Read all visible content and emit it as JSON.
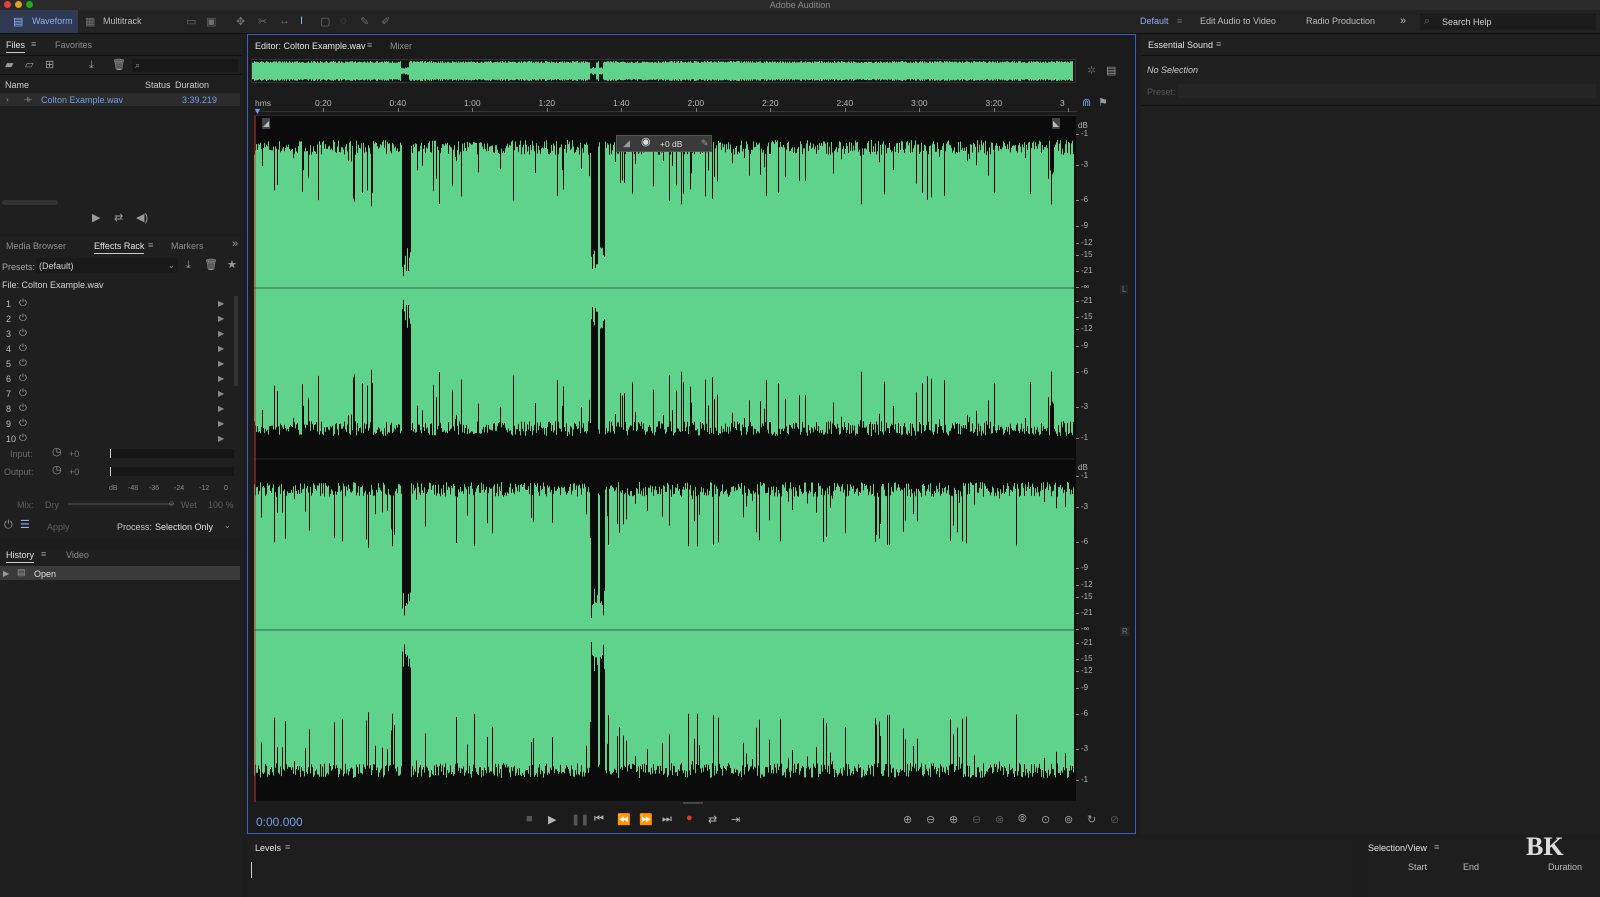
{
  "app": {
    "title": "Adobe Audition"
  },
  "topbar": {
    "waveform_label": "Waveform",
    "multitrack_label": "Multitrack",
    "workspaces": [
      "Default",
      "Edit Audio to Video",
      "Radio Production"
    ],
    "search_placeholder": "Search Help"
  },
  "files_panel": {
    "tabs": [
      "Files",
      "Favorites"
    ],
    "columns": {
      "name": "Name",
      "status": "Status",
      "duration": "Duration"
    },
    "file": {
      "name": "Colton Example.wav",
      "duration": "3:39.219"
    }
  },
  "effects_panel": {
    "tabs": [
      "Media Browser",
      "Effects Rack",
      "Markers"
    ],
    "presets_label": "Presets:",
    "presets_value": "(Default)",
    "file_label": "File: Colton Example.wav",
    "slots": [
      "1",
      "2",
      "3",
      "4",
      "5",
      "6",
      "7",
      "8",
      "9",
      "10"
    ],
    "input_label": "Input:",
    "input_value": "+0",
    "output_label": "Output:",
    "output_value": "+0",
    "meter_scale": [
      "dB",
      "-48",
      "-36",
      "-24",
      "-12",
      "0"
    ],
    "mix_label": "Mix:",
    "dry_label": "Dry",
    "wet_label": "Wet",
    "wet_value": "100 %",
    "apply_label": "Apply",
    "process_label": "Process:",
    "process_value": "Selection Only"
  },
  "history_panel": {
    "tabs": [
      "History",
      "Video"
    ],
    "items": [
      "Open"
    ]
  },
  "editor": {
    "tab": "Editor: Colton Example.wav",
    "mixer_tab": "Mixer",
    "ruler_unit": "hms",
    "ruler_ticks": [
      "0:20",
      "0:40",
      "1:00",
      "1:20",
      "1:40",
      "2:00",
      "2:20",
      "2:40",
      "3:00",
      "3:20",
      "3"
    ],
    "hud_gain": "+0 dB",
    "db_unit": "dB",
    "db_scale_top": [
      "-1",
      "-3",
      "-6",
      "-9",
      "-12",
      "-15",
      "-21",
      "-∞",
      "-21",
      "-15",
      "-12",
      "-9",
      "-6",
      "-3",
      "-1"
    ],
    "db_scale_bottom": [
      "-1",
      "-3",
      "-6",
      "-9",
      "-12",
      "-15",
      "-21",
      "-∞",
      "-21",
      "-15",
      "-12",
      "-9",
      "-6",
      "-3",
      "-1"
    ],
    "channel_left": "L",
    "channel_right": "R",
    "timecode": "0:00.000",
    "waveform_color": "#5fd38c"
  },
  "essential_sound": {
    "title": "Essential Sound",
    "no_selection": "No Selection",
    "preset_label": "Preset:"
  },
  "levels_panel": {
    "title": "Levels"
  },
  "selection_panel": {
    "title": "Selection/View",
    "columns": [
      "Start",
      "End",
      "Duration"
    ]
  },
  "watermark": {
    "text": "BK"
  }
}
